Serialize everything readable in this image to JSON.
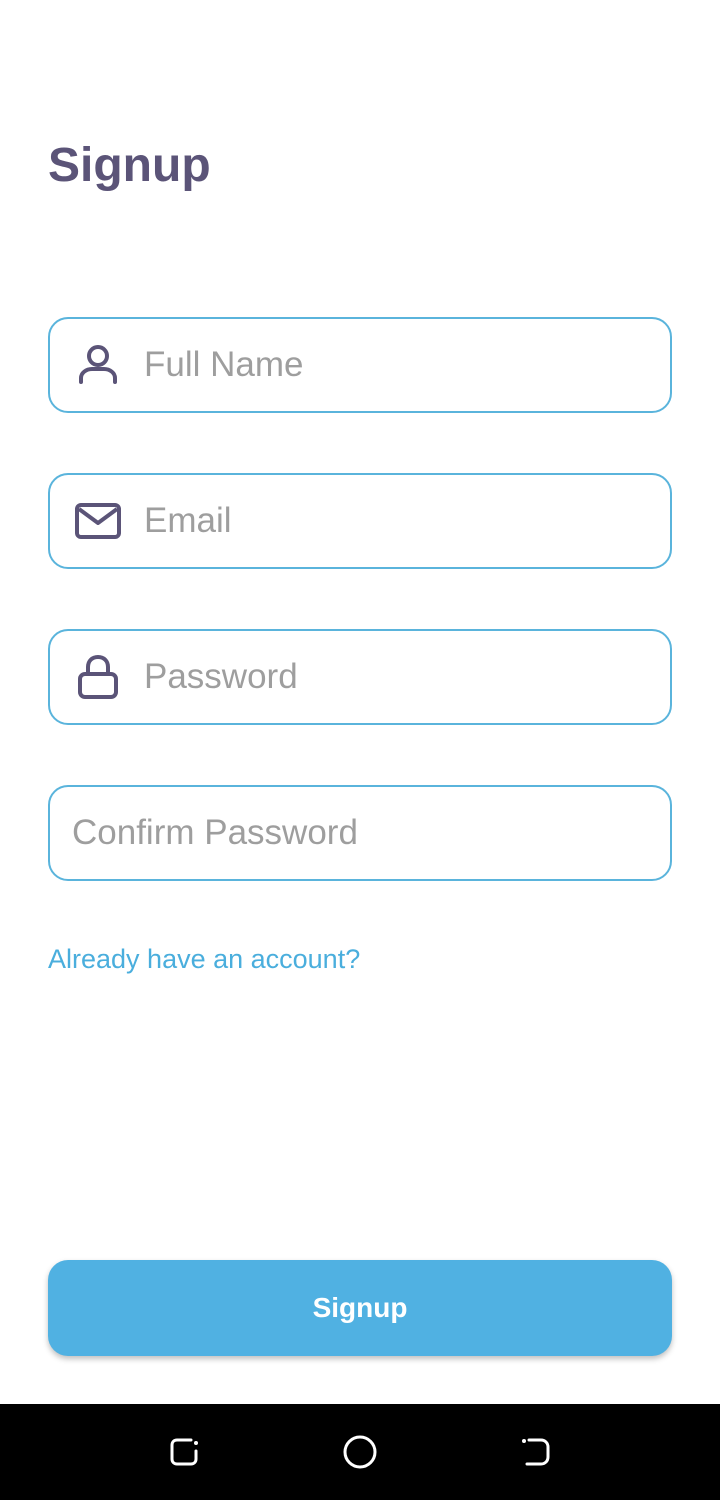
{
  "page": {
    "title": "Signup"
  },
  "form": {
    "full_name": {
      "value": "",
      "placeholder": "Full Name",
      "icon": "person-icon"
    },
    "email": {
      "value": "",
      "placeholder": "Email",
      "icon": "envelope-icon"
    },
    "password": {
      "value": "",
      "placeholder": "Password",
      "icon": "lock-icon"
    },
    "confirm_password": {
      "value": "",
      "placeholder": "Confirm Password"
    },
    "login_link": "Already have an account?",
    "submit_label": "Signup"
  },
  "navbar": {
    "buttons": [
      "recent-apps-icon",
      "home-icon",
      "back-icon"
    ]
  },
  "colors": {
    "title": "#5b5478",
    "field_border": "#5ab4dc",
    "icon": "#5b5478",
    "link": "#4aaedd",
    "button": "#50b1e2",
    "placeholder": "#9e9e9e"
  }
}
